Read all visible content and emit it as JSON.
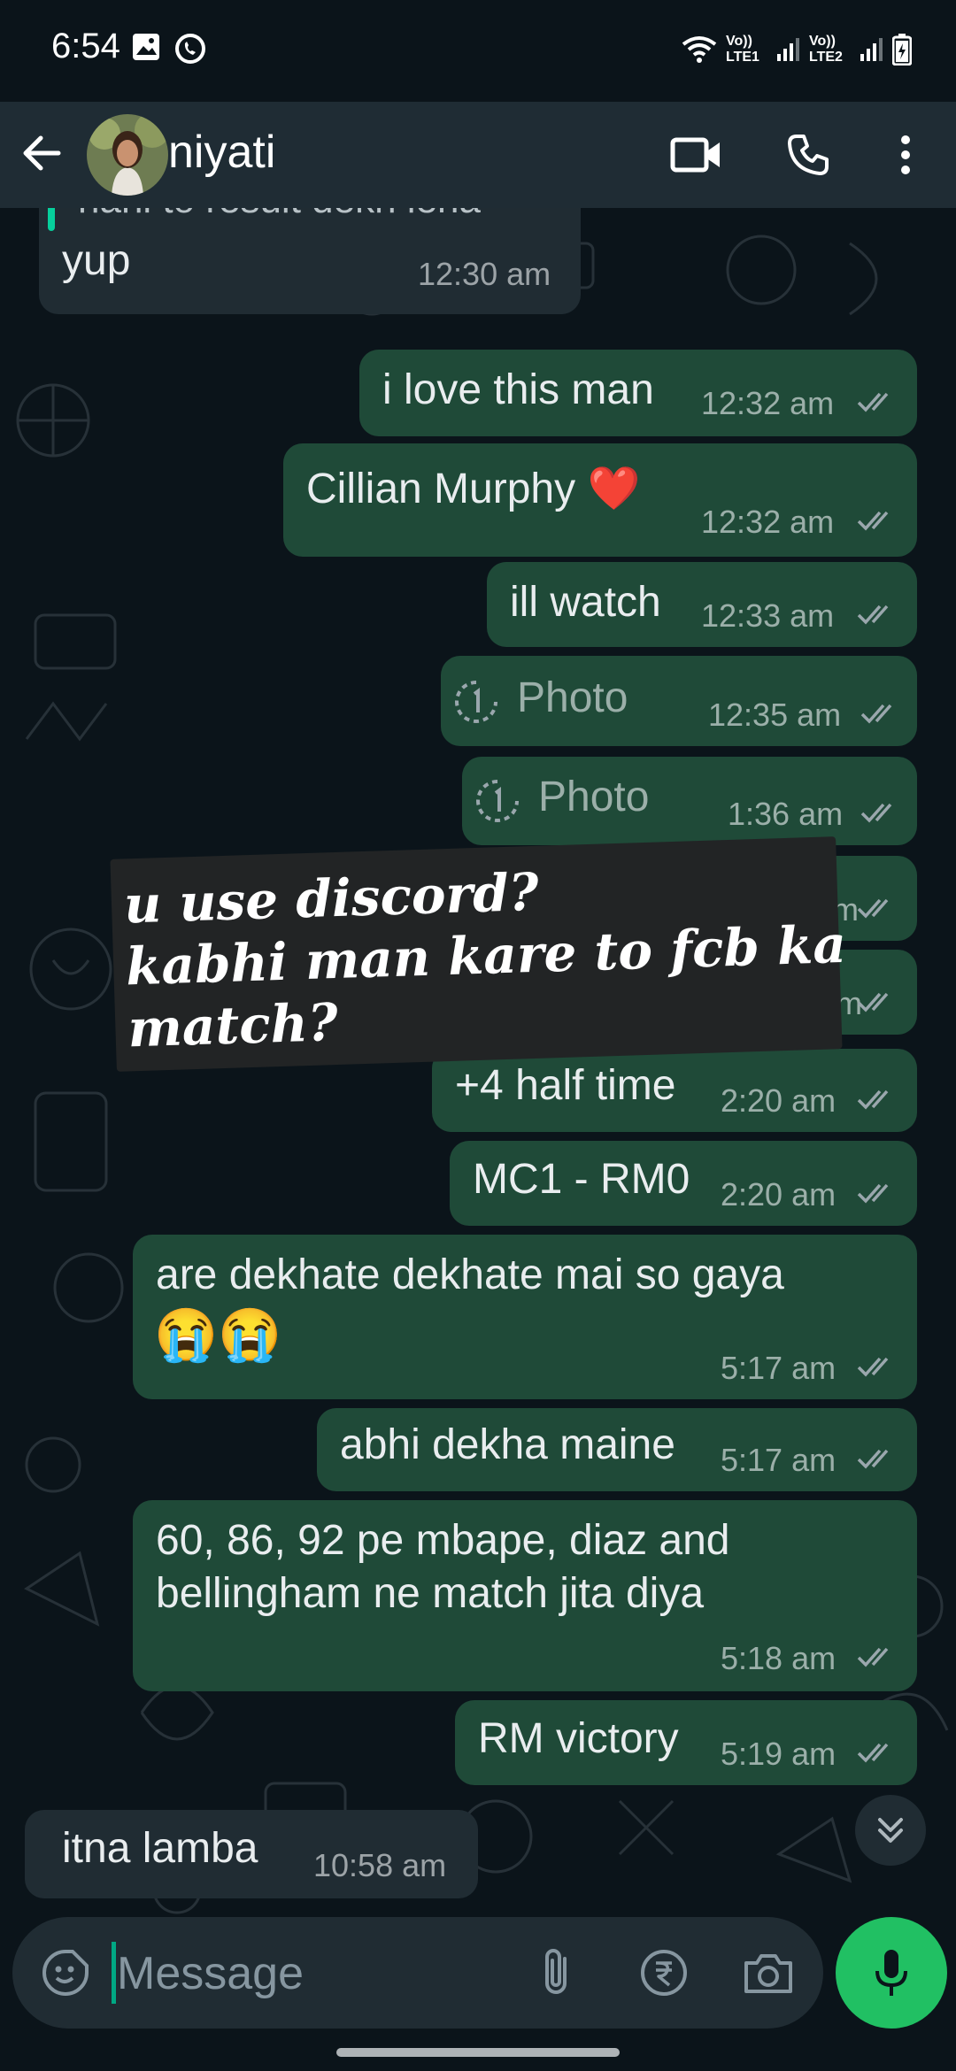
{
  "status_bar": {
    "time": "6:54",
    "sim1": "Vo)) LTE1",
    "sim2": "Vo)) LTE2"
  },
  "header": {
    "contact_name": "niyati",
    "icons": [
      "back-arrow-icon",
      "video-call-icon",
      "voice-call-icon",
      "more-options-icon"
    ]
  },
  "messages": [
    {
      "dir": "in",
      "text": "hahi to result dekh lena",
      "time": ""
    },
    {
      "dir": "in",
      "text": "yup",
      "time": "12:30 am"
    },
    {
      "dir": "out",
      "text": "i love this man",
      "time": "12:32 am"
    },
    {
      "dir": "out",
      "text": "Cillian Murphy ❤️",
      "time": "12:32 am"
    },
    {
      "dir": "out",
      "text": "ill watch",
      "time": "12:33 am"
    },
    {
      "dir": "out",
      "text": "Photo",
      "time": "12:35 am"
    },
    {
      "dir": "out",
      "text": "Photo",
      "time": "1:36 am"
    },
    {
      "dir": "out",
      "text": "",
      "time": "m"
    },
    {
      "dir": "out",
      "text": "",
      "time": "m"
    },
    {
      "dir": "out",
      "text": "+4 half time",
      "time": "2:20 am"
    },
    {
      "dir": "out",
      "text": "MC1 - RM0",
      "time": "2:20 am"
    },
    {
      "dir": "out",
      "line1": "are dekhate dekhate mai so gaya",
      "line2": "😭😭",
      "time": "5:17 am"
    },
    {
      "dir": "out",
      "text": "abhi dekha maine",
      "time": "5:17 am"
    },
    {
      "dir": "out",
      "line1": "60, 86, 92 pe mbape, diaz and",
      "line2": "bellingham ne match jita diya",
      "time": "5:18 am"
    },
    {
      "dir": "out",
      "text": "RM victory",
      "time": "5:19 am"
    },
    {
      "dir": "in",
      "text": "itna lamba",
      "time": "10:58 am"
    }
  ],
  "sticker": {
    "line1": "u use discord?",
    "line2": "kabhi man kare to fcb ka",
    "line3": "match?"
  },
  "composer": {
    "placeholder": "Message"
  },
  "colors": {
    "background": "#0b141a",
    "header": "#1f2c34",
    "outgoing_bubble": "#1f4a38",
    "incoming_bubble": "#202c33",
    "mic_button": "#21c063"
  }
}
